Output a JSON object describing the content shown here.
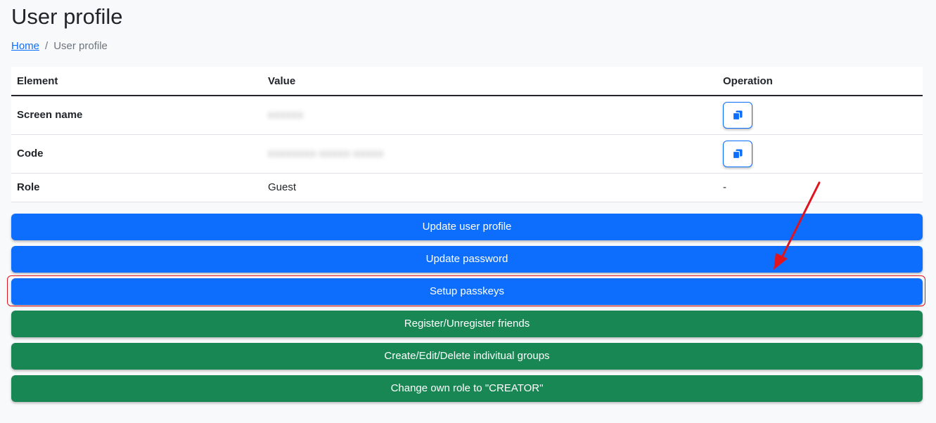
{
  "page": {
    "title": "User profile",
    "breadcrumb": {
      "home": "Home",
      "separator": "/",
      "current": "User profile"
    }
  },
  "table": {
    "headers": [
      "Element",
      "Value",
      "Operation"
    ],
    "rows": [
      {
        "element": "Screen name",
        "value": "xxxxxx",
        "operation": "copy-icon"
      },
      {
        "element": "Code",
        "value": "xxxxxxxx-xxxxx-xxxxx",
        "operation": "copy-icon"
      },
      {
        "element": "Role",
        "value": "Guest",
        "operation": "-"
      }
    ]
  },
  "buttons": {
    "update_profile": "Update user profile",
    "update_password": "Update password",
    "setup_passkeys": "Setup passkeys",
    "register_friends": "Register/Unregister friends",
    "groups": "Create/Edit/Delete indivitual groups",
    "change_role": "Change own role to \"CREATOR\""
  },
  "colors": {
    "primary": "#0d6efd",
    "success": "#198754",
    "annotation": "#e0141e",
    "background": "#f8f9fa"
  }
}
